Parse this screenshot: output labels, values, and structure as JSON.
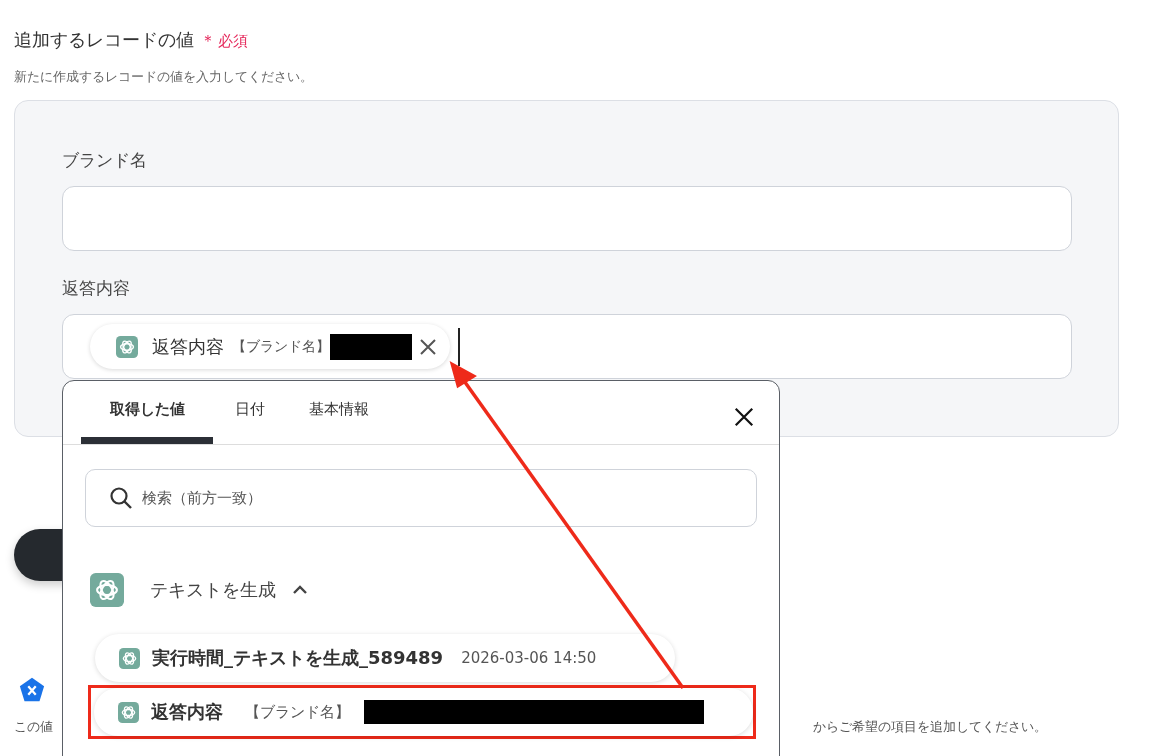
{
  "section": {
    "title": "追加するレコードの値",
    "required_mark": "＊",
    "required_label": "必須",
    "description": "新たに作成するレコードの値を入力してください。"
  },
  "fields": [
    {
      "label": "ブランド名"
    },
    {
      "label": "返答内容",
      "token": {
        "name": "返答内容",
        "source": "【ブランド名】"
      }
    }
  ],
  "dropdown": {
    "tabs": [
      {
        "label": "取得した値",
        "selected": true
      },
      {
        "label": "日付",
        "selected": false
      },
      {
        "label": "基本情報",
        "selected": false
      }
    ],
    "search": {
      "placeholder": "検索（前方一致）"
    },
    "group": {
      "title": "テキストを生成",
      "expanded": true,
      "items": [
        {
          "name": "実行時間_テキストを生成_589489",
          "value": "2026-03-06 14:50",
          "highlighted": false
        },
        {
          "name": "返答内容",
          "value": "【ブランド名】",
          "highlighted": true
        }
      ]
    }
  },
  "behind": {
    "description_start": "この値",
    "description_end": "からご希望の項目を追加してください。"
  }
}
